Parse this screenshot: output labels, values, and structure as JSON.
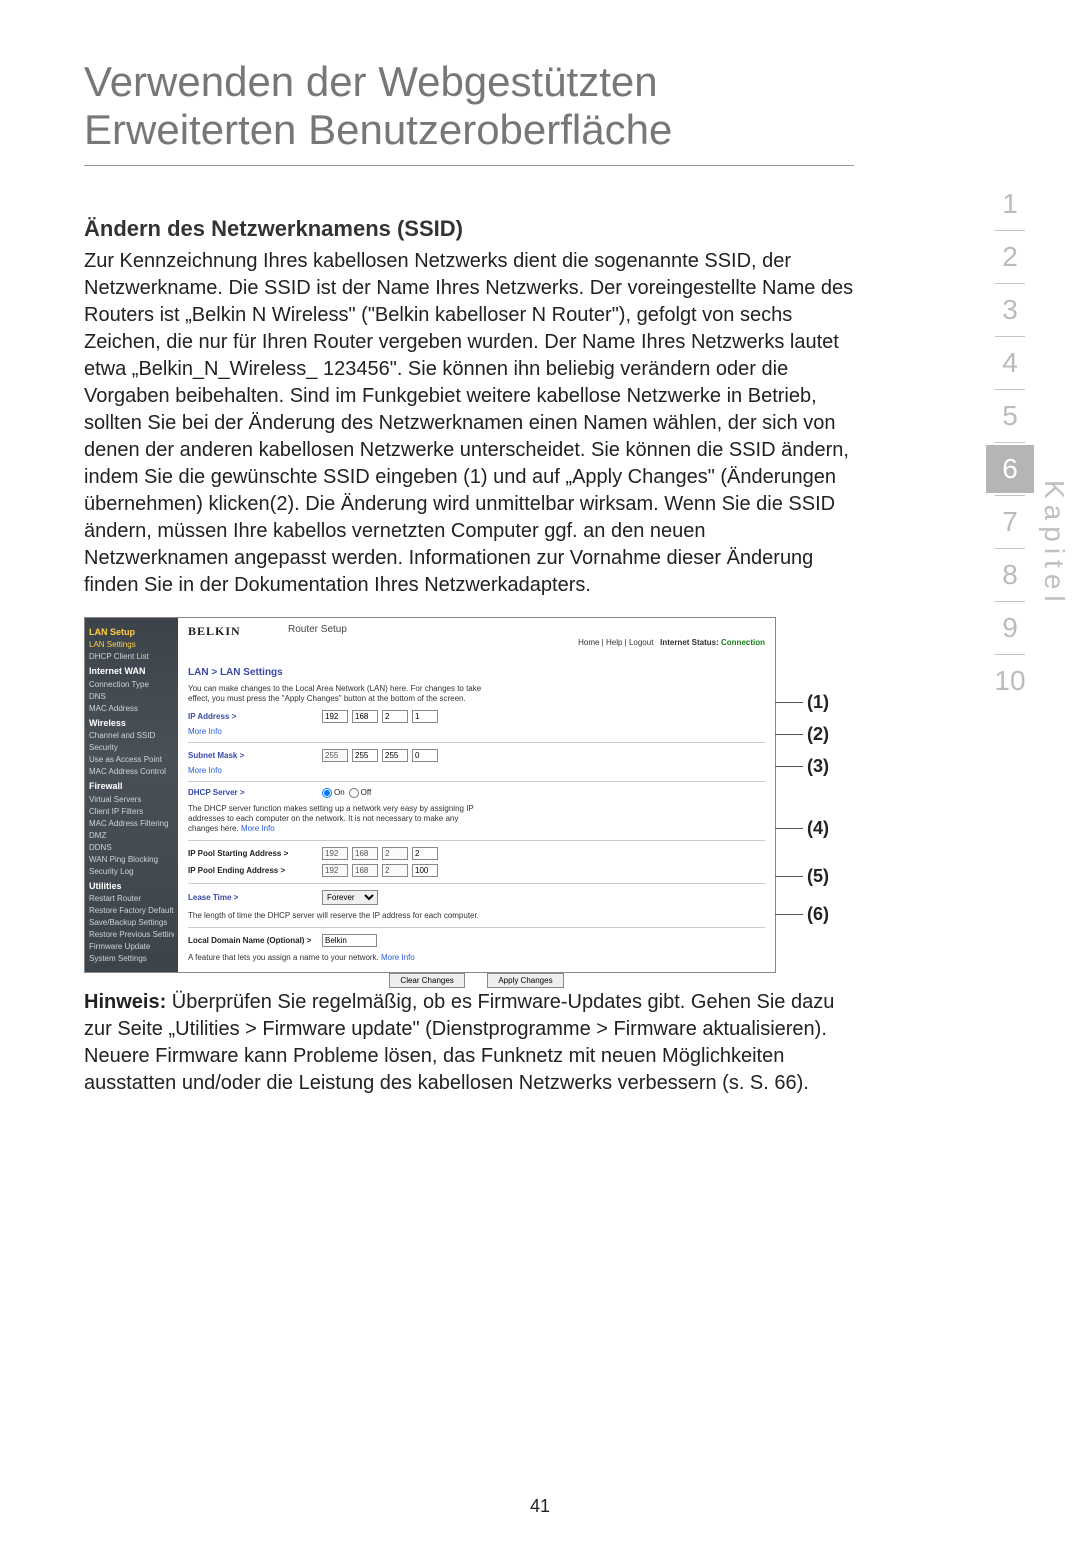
{
  "title": "Verwenden der Webgestützten Erweiterten Benutzeroberfläche",
  "section_heading": "Ändern des Netzwerknamens (SSID)",
  "body_text": " Zur Kennzeichnung Ihres kabellosen Netzwerks dient die sogenannte SSID, der Netzwerkname. Die SSID ist der Name Ihres Netzwerks. Der voreingestellte Name des Routers ist „Belkin N Wireless\" (\"Belkin kabelloser N Router\"), gefolgt von sechs Zeichen, die nur für Ihren Router vergeben wurden. Der Name Ihres Netzwerks lautet etwa „Belkin_N_Wireless_ 123456\". Sie können ihn beliebig verändern oder die Vorgaben beibehalten. Sind im Funkgebiet weitere kabellose Netzwerke in Betrieb, sollten Sie bei der Änderung des Netzwerknamen einen Namen wählen, der sich von denen der anderen kabellosen Netzwerke unterscheidet. Sie können die SSID ändern, indem Sie die gewünschte SSID eingeben (1) und auf „Apply Changes\" (Änderungen übernehmen) klicken(2). Die Änderung wird unmittelbar wirksam. Wenn Sie die SSID ändern, müssen Ihre kabellos vernetzten Computer ggf. an den neuen Netzwerknamen angepasst werden. Informationen zur Vornahme dieser Änderung finden Sie in der Dokumentation Ihres Netzwerkadapters.",
  "hinweis_label": "Hinweis:",
  "hinweis_text": " Überprüfen Sie regelmäßig, ob es Firmware-Updates gibt. Gehen Sie dazu zur Seite „Utilities > Firmware update\" (Dienstprogramme > Firmware aktualisieren). Neuere Firmware kann Probleme lösen, das Funknetz mit neuen Möglichkeiten ausstatten und/oder die Leistung des kabellosen Netzwerks verbessern (s. S. 66).",
  "page_number": "41",
  "chapnav": {
    "items": [
      "1",
      "2",
      "3",
      "4",
      "5",
      "6",
      "7",
      "8",
      "9",
      "10"
    ],
    "current_index": 5
  },
  "kapitel_label": "Kapitel",
  "callouts": [
    "(1)",
    "(2)",
    "(3)",
    "(4)",
    "(5)",
    "(6)"
  ],
  "shot": {
    "logo": "BELKIN",
    "setup_title": "Router Setup",
    "toplinks": {
      "home": "Home",
      "help": "Help",
      "logout": "Logout",
      "status_label": "Internet Status:",
      "status_value": "Connection"
    },
    "crumb": "LAN > LAN Settings",
    "intro": "You can make changes to the Local Area Network (LAN) here. For changes to take effect, you must press the \"Apply Changes\" button at the bottom of the screen.",
    "ip_label": "IP Address >",
    "ip": [
      "192",
      "168",
      "2",
      "1"
    ],
    "more_info": "More Info",
    "subnet_label": "Subnet Mask >",
    "subnet": [
      "255",
      "255",
      "255",
      "0"
    ],
    "dhcp_label": "DHCP Server >",
    "dhcp_on": "On",
    "dhcp_off": "Off",
    "dhcp_note": "The DHCP server function makes setting up a network very easy by assigning IP addresses to each computer on the network. It is not necessary to make any changes here.",
    "pool_start_label": "IP Pool Starting Address >",
    "pool_start": [
      "192",
      "168",
      "2",
      "2"
    ],
    "pool_end_label": "IP Pool Ending Address >",
    "pool_end": [
      "192",
      "168",
      "2",
      "100"
    ],
    "lease_label": "Lease Time >",
    "lease_value": "Forever",
    "lease_note": "The length of time the DHCP server will reserve the IP address for each computer.",
    "domain_label": "Local Domain Name (Optional) >",
    "domain_value": "Belkin",
    "domain_note": "A feature that lets you assign a name to your network.",
    "clear_btn": "Clear Changes",
    "apply_btn": "Apply Changes",
    "sidebar": [
      {
        "t": "LAN Setup",
        "cls": "sec hl"
      },
      {
        "t": "LAN Settings",
        "cls": "item hl"
      },
      {
        "t": "DHCP Client List",
        "cls": "item"
      },
      {
        "t": "Internet WAN",
        "cls": "sec"
      },
      {
        "t": "Connection Type",
        "cls": "item"
      },
      {
        "t": "DNS",
        "cls": "item"
      },
      {
        "t": "MAC Address",
        "cls": "item"
      },
      {
        "t": "Wireless",
        "cls": "sec"
      },
      {
        "t": "Channel and SSID",
        "cls": "item"
      },
      {
        "t": "Security",
        "cls": "item"
      },
      {
        "t": "Use as Access Point",
        "cls": "item"
      },
      {
        "t": "MAC Address Control",
        "cls": "item"
      },
      {
        "t": "Firewall",
        "cls": "sec"
      },
      {
        "t": "Virtual Servers",
        "cls": "item"
      },
      {
        "t": "Client IP Filters",
        "cls": "item"
      },
      {
        "t": "MAC Address Filtering",
        "cls": "item"
      },
      {
        "t": "DMZ",
        "cls": "item"
      },
      {
        "t": "DDNS",
        "cls": "item"
      },
      {
        "t": "WAN Ping Blocking",
        "cls": "item"
      },
      {
        "t": "Security Log",
        "cls": "item"
      },
      {
        "t": "Utilities",
        "cls": "sec"
      },
      {
        "t": "Restart Router",
        "cls": "item"
      },
      {
        "t": "Restore Factory Defaults",
        "cls": "item"
      },
      {
        "t": "Save/Backup Settings",
        "cls": "item"
      },
      {
        "t": "Restore Previous Settings",
        "cls": "item"
      },
      {
        "t": "Firmware Update",
        "cls": "item"
      },
      {
        "t": "System Settings",
        "cls": "item"
      }
    ]
  }
}
